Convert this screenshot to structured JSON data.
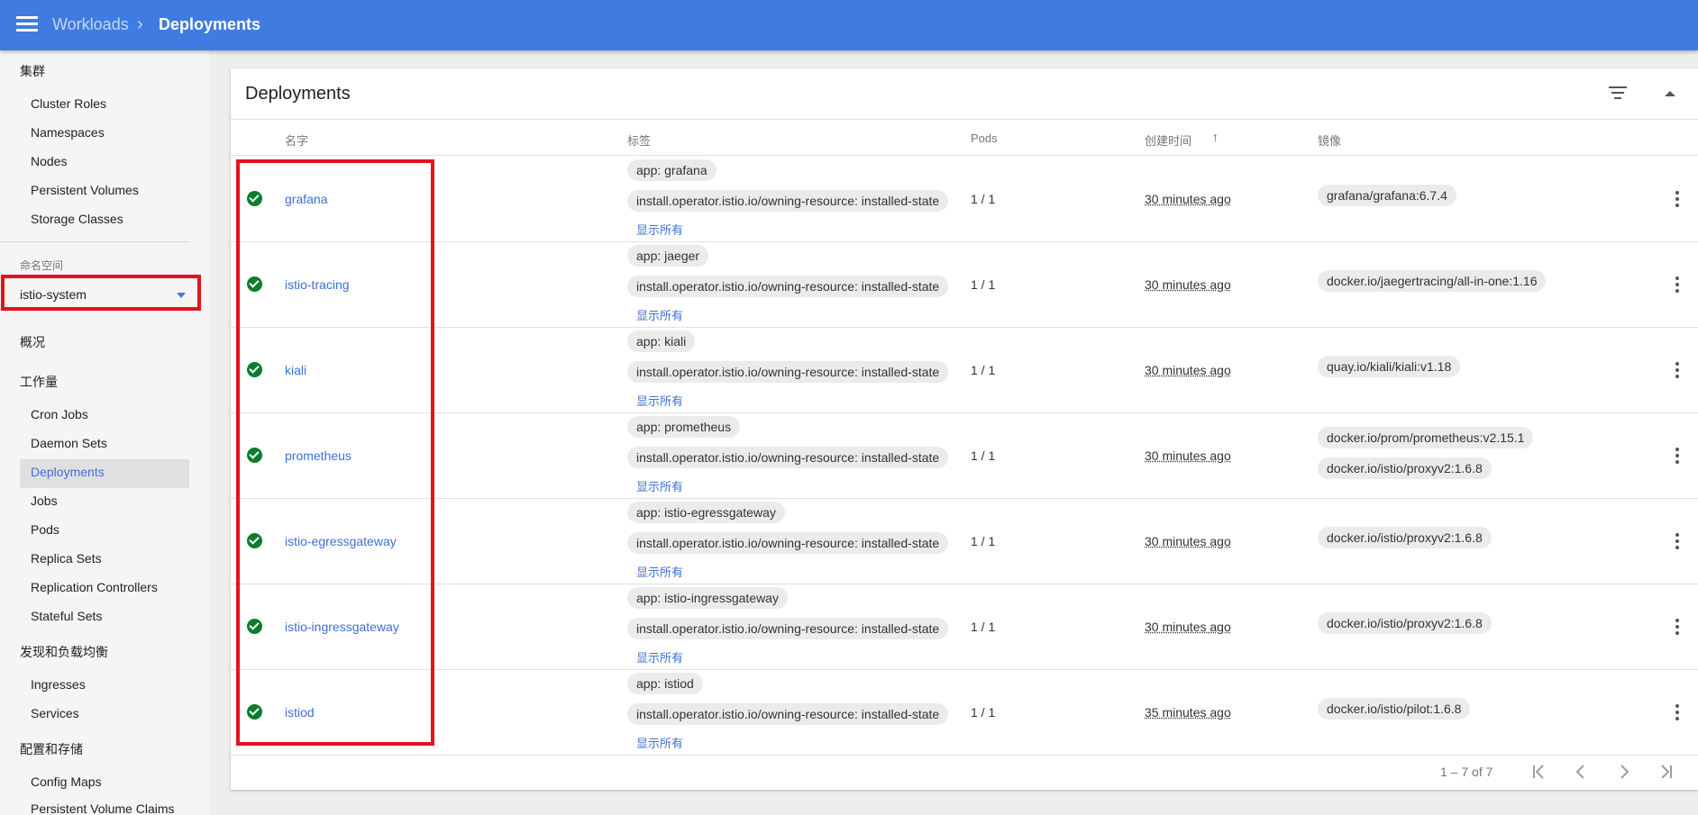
{
  "topbar": {
    "breadcrumb_parent": "Workloads",
    "breadcrumb_separator": "›",
    "breadcrumb_current": "Deployments",
    "accent_color": "#3f7be0"
  },
  "sidebar": {
    "cluster_header": "集群",
    "cluster_items": [
      "Cluster Roles",
      "Namespaces",
      "Nodes",
      "Persistent Volumes",
      "Storage Classes"
    ],
    "namespace_label": "命名空间",
    "namespace_value": "istio-system",
    "overview": "概况",
    "workloads_header": "工作量",
    "workload_items": [
      "Cron Jobs",
      "Daemon Sets",
      "Deployments",
      "Jobs",
      "Pods",
      "Replica Sets",
      "Replication Controllers",
      "Stateful Sets"
    ],
    "discovery_header": "发现和负载均衡",
    "discovery_items": [
      "Ingresses",
      "Services"
    ],
    "config_header": "配置和存储",
    "config_items": [
      "Config Maps",
      "Persistent Volume Claims"
    ]
  },
  "card": {
    "title": "Deployments",
    "columns": {
      "name": "名字",
      "labels": "标签",
      "pods": "Pods",
      "created": "创建时间",
      "images": "镜像"
    },
    "rows": [
      {
        "name": "grafana",
        "app_label": "app: grafana",
        "owner_label": "install.operator.istio.io/owning-resource: installed-state",
        "show_all": "显示所有",
        "pods": "1 / 1",
        "created": "30 minutes ago",
        "images": [
          "grafana/grafana:6.7.4"
        ]
      },
      {
        "name": "istio-tracing",
        "app_label": "app: jaeger",
        "owner_label": "install.operator.istio.io/owning-resource: installed-state",
        "show_all": "显示所有",
        "pods": "1 / 1",
        "created": "30 minutes ago",
        "images": [
          "docker.io/jaegertracing/all-in-one:1.16"
        ]
      },
      {
        "name": "kiali",
        "app_label": "app: kiali",
        "owner_label": "install.operator.istio.io/owning-resource: installed-state",
        "show_all": "显示所有",
        "pods": "1 / 1",
        "created": "30 minutes ago",
        "images": [
          "quay.io/kiali/kiali:v1.18"
        ]
      },
      {
        "name": "prometheus",
        "app_label": "app: prometheus",
        "owner_label": "install.operator.istio.io/owning-resource: installed-state",
        "show_all": "显示所有",
        "pods": "1 / 1",
        "created": "30 minutes ago",
        "images": [
          "docker.io/prom/prometheus:v2.15.1",
          "docker.io/istio/proxyv2:1.6.8"
        ]
      },
      {
        "name": "istio-egressgateway",
        "app_label": "app: istio-egressgateway",
        "owner_label": "install.operator.istio.io/owning-resource: installed-state",
        "show_all": "显示所有",
        "pods": "1 / 1",
        "created": "30 minutes ago",
        "images": [
          "docker.io/istio/proxyv2:1.6.8"
        ]
      },
      {
        "name": "istio-ingressgateway",
        "app_label": "app: istio-ingressgateway",
        "owner_label": "install.operator.istio.io/owning-resource: installed-state",
        "show_all": "显示所有",
        "pods": "1 / 1",
        "created": "30 minutes ago",
        "images": [
          "docker.io/istio/proxyv2:1.6.8"
        ]
      },
      {
        "name": "istiod",
        "app_label": "app: istiod",
        "owner_label": "install.operator.istio.io/owning-resource: installed-state",
        "show_all": "显示所有",
        "pods": "1 / 1",
        "created": "35 minutes ago",
        "images": [
          "docker.io/istio/pilot:1.6.8"
        ]
      }
    ],
    "pagination": "1 – 7 of 7"
  }
}
